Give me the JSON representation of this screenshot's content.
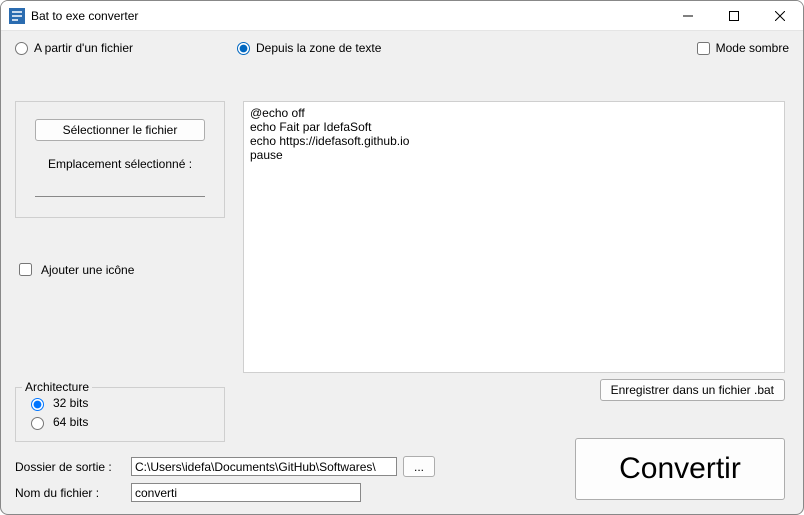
{
  "window": {
    "title": "Bat to exe converter"
  },
  "source": {
    "from_file_label": "A partir d'un fichier",
    "from_text_label": "Depuis la zone de texte",
    "selected": "text"
  },
  "dark_mode": {
    "label": "Mode sombre",
    "checked": false
  },
  "filebox": {
    "select_button": "Sélectionner le fichier",
    "location_label": "Emplacement sélectionné :",
    "location_value": ""
  },
  "icon_option": {
    "label": "Ajouter une icône",
    "checked": false
  },
  "code": "@echo off\necho Fait par IdefaSoft\necho https://idefasoft.github.io\npause",
  "save_bat_button": "Enregistrer dans un fichier .bat",
  "architecture": {
    "legend": "Architecture",
    "opt32": "32 bits",
    "opt64": "64 bits",
    "selected": "32"
  },
  "output": {
    "folder_label": "Dossier de sortie :",
    "folder_value": "C:\\Users\\idefa\\Documents\\GitHub\\Softwares\\",
    "browse_label": "...",
    "name_label": "Nom du fichier :",
    "name_value": "converti"
  },
  "convert_button": "Convertir"
}
